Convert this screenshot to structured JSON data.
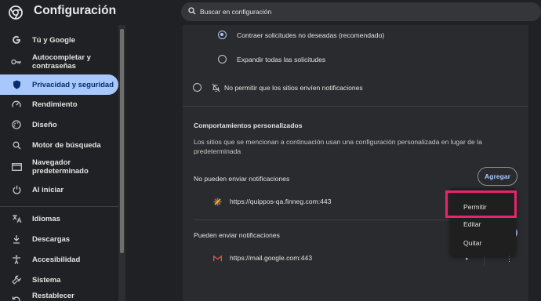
{
  "header": {
    "title": "Configuración",
    "search_placeholder": "Buscar en configuración"
  },
  "sidebar": {
    "items": [
      {
        "label": "Tú y Google",
        "icon": "google-icon"
      },
      {
        "label": "Autocompletar y contraseñas",
        "icon": "key-icon"
      },
      {
        "label": "Privacidad y seguridad",
        "icon": "shield-icon",
        "active": true
      },
      {
        "label": "Rendimiento",
        "icon": "speedometer-icon"
      },
      {
        "label": "Diseño",
        "icon": "palette-icon"
      },
      {
        "label": "Motor de búsqueda",
        "icon": "search-icon"
      },
      {
        "label": "Navegador predeterminado",
        "icon": "browser-icon"
      },
      {
        "label": "Al iniciar",
        "icon": "power-icon"
      },
      {
        "label": "Idiomas",
        "icon": "translate-icon"
      },
      {
        "label": "Descargas",
        "icon": "download-icon"
      },
      {
        "label": "Accesibilidad",
        "icon": "accessibility-icon"
      },
      {
        "label": "Sistema",
        "icon": "wrench-icon"
      },
      {
        "label": "Restablecer configuración",
        "icon": "reset-icon"
      }
    ]
  },
  "main": {
    "option_collapse": "Contraer solicitudes no deseadas (recomendado)",
    "option_expand": "Expandir todas las solicitudes",
    "option_block": "No permitir que los sitios envíen notificaciones",
    "custom_title": "Comportamientos personalizados",
    "custom_desc_line1": "Los sitios que se mencionan a continuación usan una configuración personalizada en lugar de la",
    "custom_desc_line2": "predeterminada",
    "blocked_title": "No pueden enviar notificaciones",
    "add_label": "Agregar",
    "blocked_site": "https://quippos-qa.finneg.com:443",
    "allowed_title": "Pueden enviar notificaciones",
    "allowed_site": "https://mail.google.com:443"
  },
  "menu": {
    "items": [
      "Permitir",
      "Editar",
      "Quitar"
    ]
  },
  "colors": {
    "accent": "#a8c7fa",
    "highlight": "#e8246c",
    "background": "#202124",
    "card": "#2a2b2e"
  }
}
